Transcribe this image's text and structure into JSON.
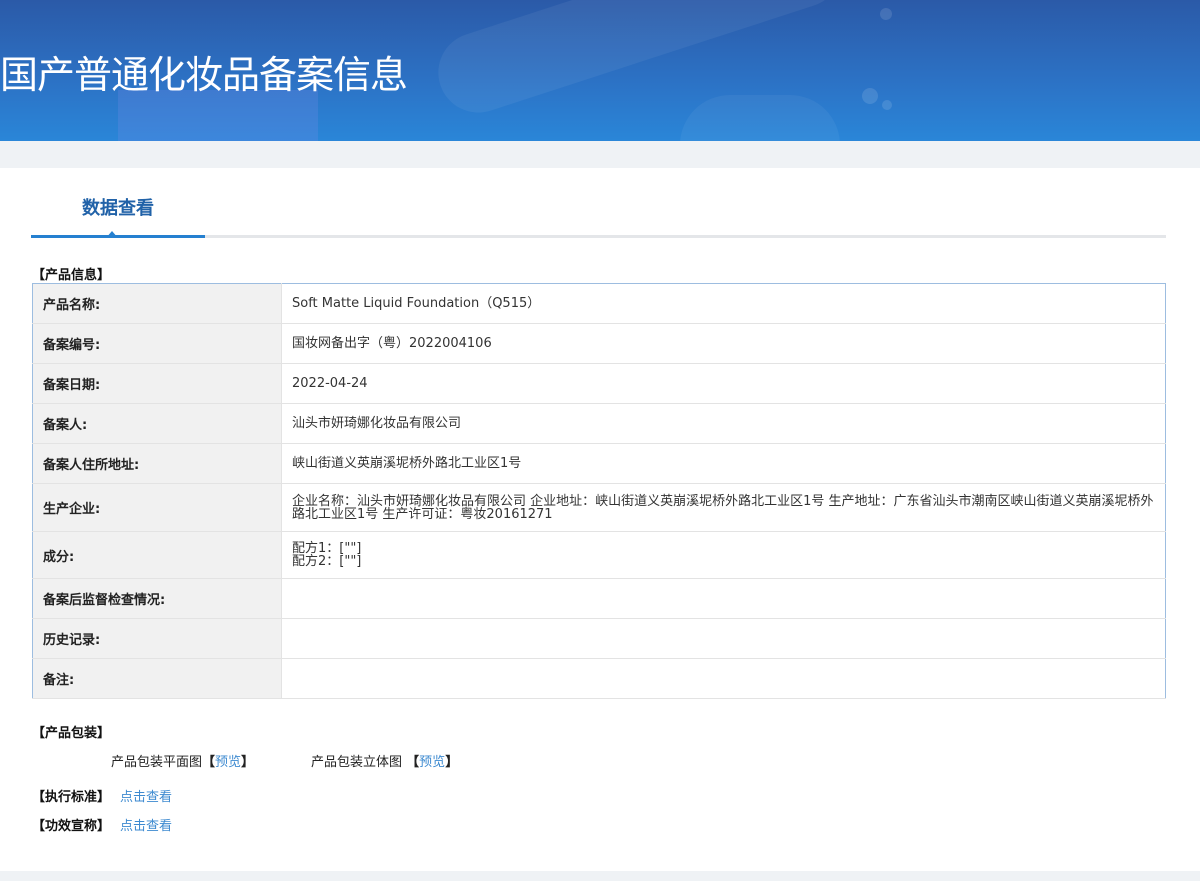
{
  "header": {
    "title": "国产普通化妆品备案信息"
  },
  "tabs": [
    {
      "label": "数据查看",
      "active": true
    }
  ],
  "product_info": {
    "section_title": "【产品信息】",
    "rows": [
      {
        "label": "产品名称:",
        "value": "Soft Matte Liquid Foundation（Q515）"
      },
      {
        "label": "备案编号:",
        "value": "国妆网备出字（粤）2022004106"
      },
      {
        "label": "备案日期:",
        "value": "2022-04-24"
      },
      {
        "label": "备案人:",
        "value": "汕头市妍琦娜化妆品有限公司"
      },
      {
        "label": "备案人住所地址:",
        "value": "峡山街道义英崩溪坭桥外路北工业区1号"
      },
      {
        "label": "生产企业:",
        "value": "企业名称：汕头市妍琦娜化妆品有限公司 企业地址：峡山街道义英崩溪坭桥外路北工业区1号 生产地址：广东省汕头市潮南区峡山街道义英崩溪坭桥外路北工业区1号 生产许可证：粤妆20161271"
      },
      {
        "label": "成分:",
        "lines": [
          "配方1：[\"\"]",
          "配方2：[\"\"]"
        ]
      },
      {
        "label": "备案后监督检查情况:",
        "value": ""
      },
      {
        "label": "历史记录:",
        "value": ""
      },
      {
        "label": "备注:",
        "value": ""
      }
    ]
  },
  "packaging": {
    "section_title": "【产品包装】",
    "flat_label": "产品包装平面图",
    "flat_link": "预览",
    "three_d_label": "产品包装立体图",
    "three_d_link": "预览",
    "bracket_open": "【",
    "bracket_close": "】"
  },
  "standard": {
    "section_title": "【执行标准】",
    "link": "点击查看"
  },
  "efficacy": {
    "section_title": "【功效宣称】",
    "link": "点击查看"
  },
  "colors": {
    "banner": "#2c73c6",
    "accent": "#2580d0",
    "link": "#3d8ad0"
  }
}
